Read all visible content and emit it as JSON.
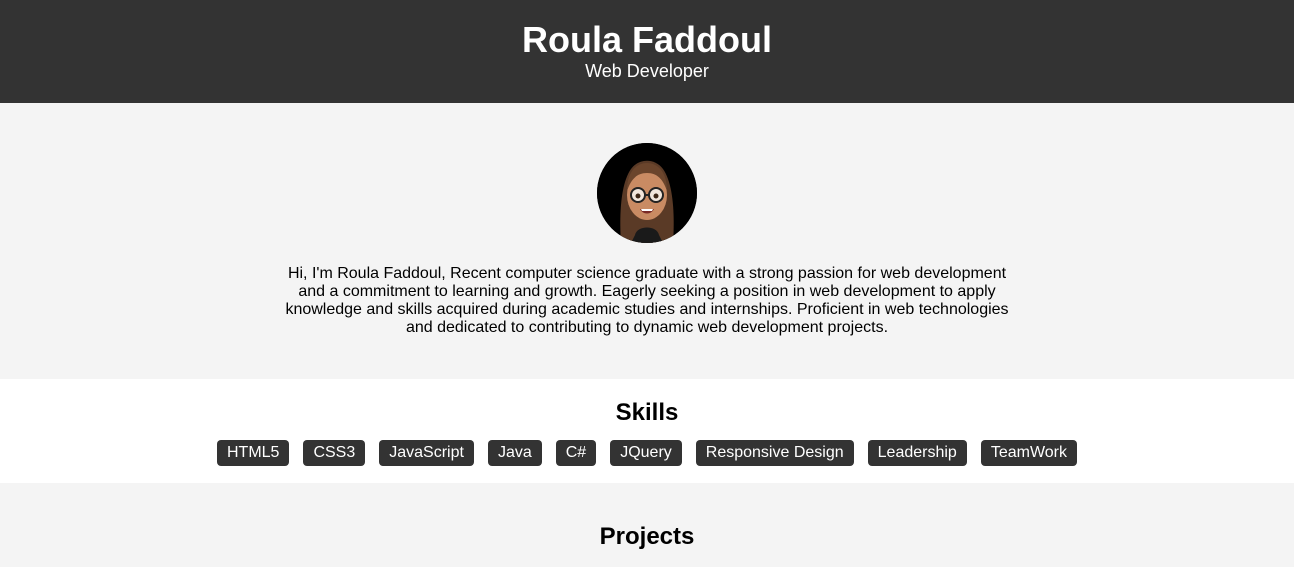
{
  "header": {
    "name": "Roula Faddoul",
    "role": "Web Developer"
  },
  "about": {
    "avatar_icon": "memoji-avatar",
    "bio": "Hi, I'm Roula Faddoul, Recent computer science graduate with a strong passion for web development and a commitment to learning and growth. Eagerly seeking a position in web development to apply knowledge and skills acquired during academic studies and internships. Proficient in web technologies and dedicated to contributing to dynamic web development projects."
  },
  "skills": {
    "title": "Skills",
    "items": [
      "HTML5",
      "CSS3",
      "JavaScript",
      "Java",
      "C#",
      "JQuery",
      "Responsive Design",
      "Leadership",
      "TeamWork"
    ]
  },
  "projects": {
    "title": "Projects"
  },
  "colors": {
    "header_bg": "#333333",
    "page_bg": "#f4f4f4",
    "section_bg": "#ffffff",
    "skill_bg": "#333333"
  }
}
